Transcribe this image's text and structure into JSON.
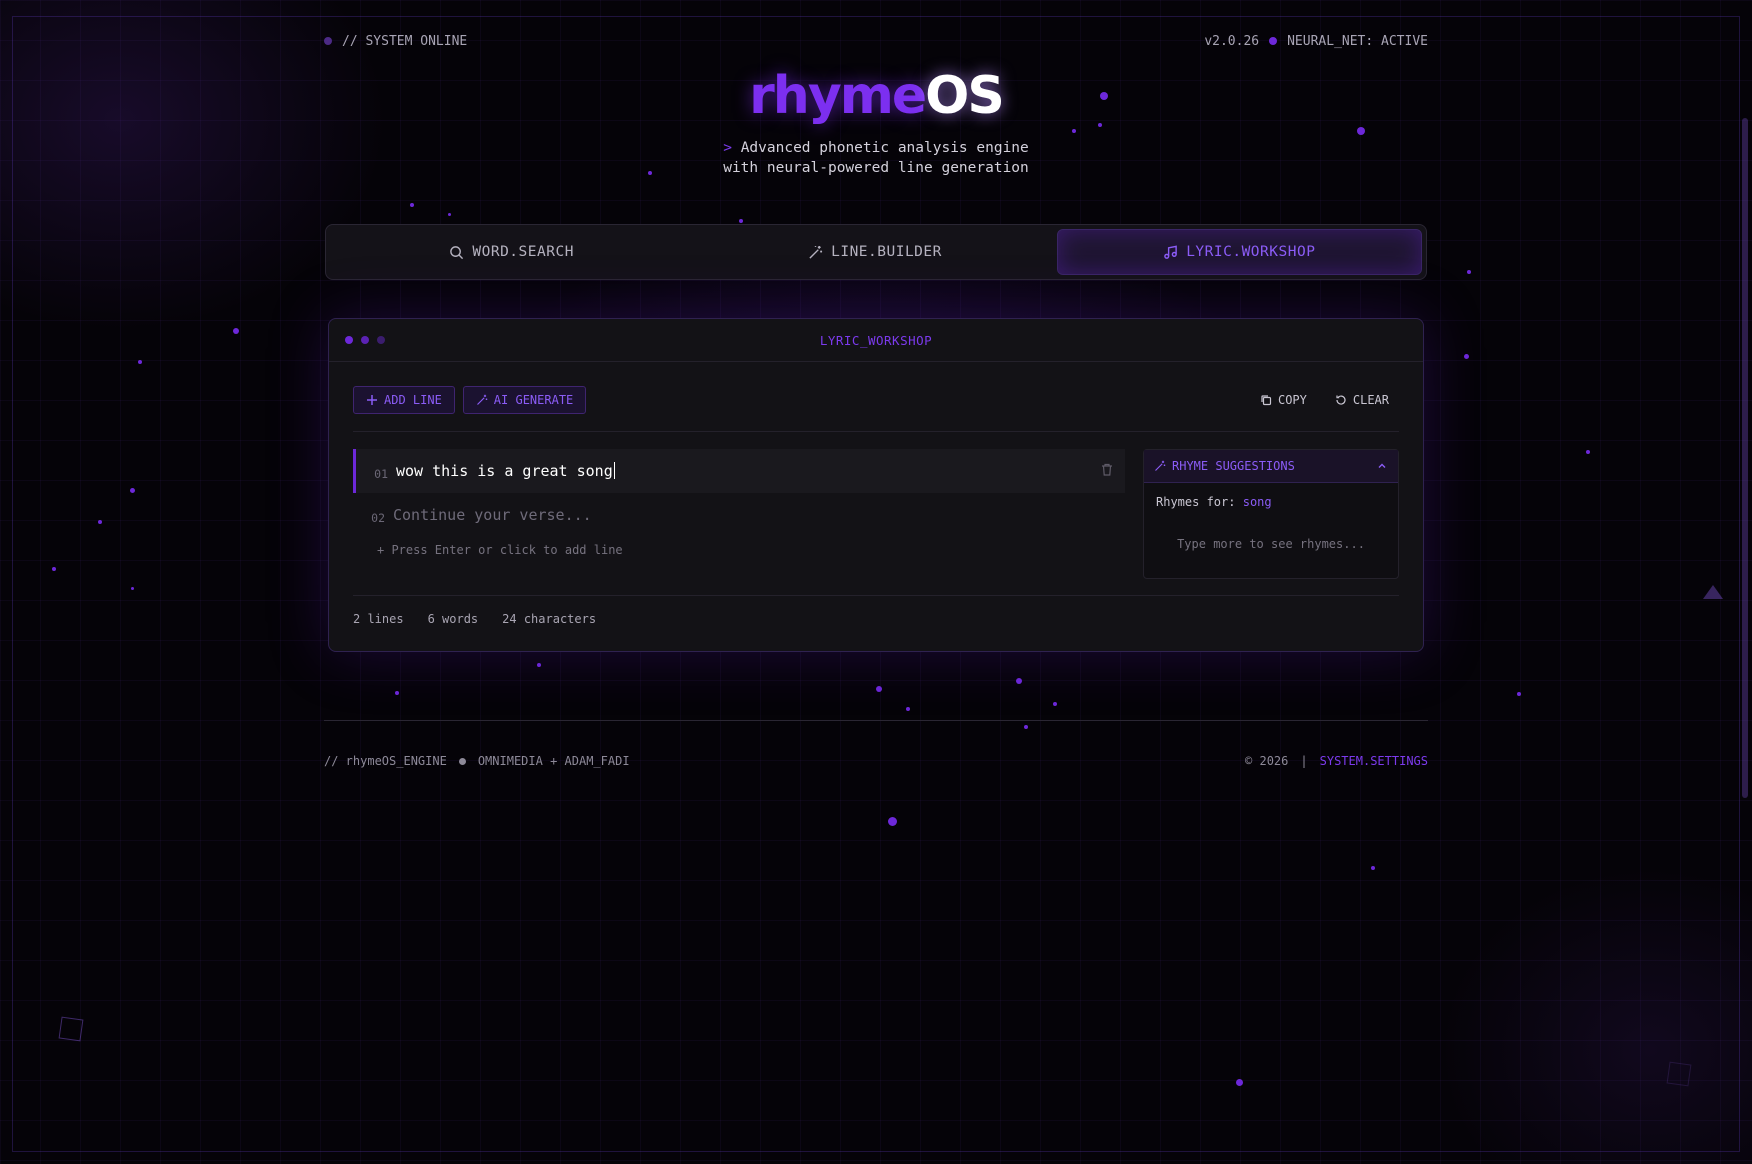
{
  "status": {
    "left_label": "// SYSTEM ONLINE",
    "version": "v2.0.26",
    "neural": "NEURAL_NET: ACTIVE"
  },
  "header": {
    "logo_part1": "rhyme",
    "logo_part2": "OS",
    "tagline_caret": ">",
    "tagline_line1": "Advanced phonetic analysis engine",
    "tagline_line2": "with neural-powered line generation"
  },
  "tabs": [
    {
      "label": "WORD.SEARCH",
      "icon": "search-icon"
    },
    {
      "label": "LINE.BUILDER",
      "icon": "wand-icon"
    },
    {
      "label": "LYRIC.WORKSHOP",
      "icon": "music-note-icon",
      "active": true
    }
  ],
  "workshop": {
    "title": "LYRIC_WORKSHOP",
    "add_line": "ADD LINE",
    "ai_generate": "AI GENERATE",
    "copy": "COPY",
    "clear": "CLEAR",
    "lines": [
      {
        "num": "01",
        "text": "wow this is a great song"
      },
      {
        "num": "02",
        "placeholder": "Continue your verse..."
      }
    ],
    "hint": "+ Press Enter or click to add line",
    "suggestions": {
      "title": "RHYME SUGGESTIONS",
      "rhymes_for_label": "Rhymes for:",
      "word": "song",
      "empty": "Type more to see rhymes..."
    },
    "stats": {
      "lines": "2 lines",
      "words": "6 words",
      "chars": "24 characters"
    }
  },
  "footer": {
    "engine": "// rhymeOS_ENGINE",
    "credits": "OMNIMEDIA + ADAM_FADI",
    "copyright": "© 2026",
    "separator": "|",
    "settings": "SYSTEM.SETTINGS"
  },
  "colors": {
    "accent": "#7c2ff0",
    "background": "#050308",
    "panel": "#131216"
  }
}
